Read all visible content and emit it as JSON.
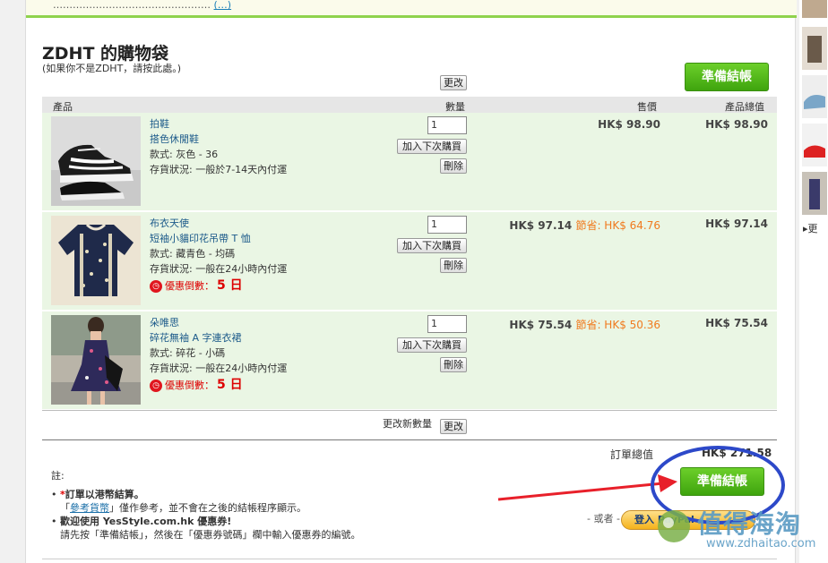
{
  "notice": {
    "text": "…………………………………………",
    "link": "(…)"
  },
  "header": {
    "title": "ZDHT 的購物袋",
    "subtitle": "(如果你不是ZDHT，請按此處。)"
  },
  "buttons": {
    "update_label": "更改",
    "checkout_label": "準備結帳",
    "save_for_later_label": "加入下次購買",
    "delete_label": "刪除"
  },
  "table": {
    "headers": {
      "product": "產品",
      "quantity": "數量",
      "price": "售價",
      "total": "產品總值"
    }
  },
  "items": [
    {
      "name_brand": "拍鞋",
      "name_desc": "搭色休閒鞋",
      "variant": "款式: 灰色 - 36",
      "availability": "存貨狀況: 一般於7-14天內付運",
      "qty": "1",
      "price": "HK$ 98.90",
      "saving": "",
      "total": "HK$ 98.90",
      "promo": "",
      "promo_days": ""
    },
    {
      "name_brand": "布衣天使",
      "name_desc": "短袖小貓印花吊帶 T 恤",
      "variant": "款式: 藏青色 - 均碼",
      "availability": "存貨狀況: 一般在24小時內付運",
      "qty": "1",
      "price": "HK$ 97.14",
      "saving": "節省: HK$ 64.76",
      "total": "HK$ 97.14",
      "promo": "優惠倒數：",
      "promo_days": "5 日"
    },
    {
      "name_brand": "朵唯思",
      "name_desc": "碎花無袖 A 字連衣裙",
      "variant": "款式: 碎花 - 小碼",
      "availability": "存貨狀況: 一般在24小時內付運",
      "qty": "1",
      "price": "HK$ 75.54",
      "saving": "節省: HK$ 50.36",
      "total": "HK$ 75.54",
      "promo": "優惠倒數：",
      "promo_days": "5 日"
    }
  ],
  "footer": {
    "update_qty_label": "更改新數量",
    "order_total_label": "訂單總值",
    "order_total_value": "HK$ 271.58",
    "or_label": "- 或者 -",
    "notes_title": "註:",
    "note1_bold": "訂單以港幣結算。",
    "note1_link": "參考貨幣",
    "note1_text": "僅作參考，並不會在之後的結帳程序顯示。",
    "note2_bold": "歡迎使用 YesStyle.com.hk 優惠券!",
    "note2_text": "請先按「準備結帳」，然後在「優惠券號碼」欄中輸入優惠券的編號。",
    "paypal_label": "登入 PayPal"
  },
  "sidebar": {
    "more_label": "▸更"
  },
  "watermark": {
    "text": "值得海淘",
    "url": "www.zdhaitao.com"
  },
  "colors": {
    "accent_green": "#4cb817",
    "row_bg": "#eaf6e4",
    "saving_orange": "#f07a1e",
    "promo_red": "#d00000",
    "annotation_blue": "#2d49c9",
    "annotation_red": "#e8202a"
  }
}
